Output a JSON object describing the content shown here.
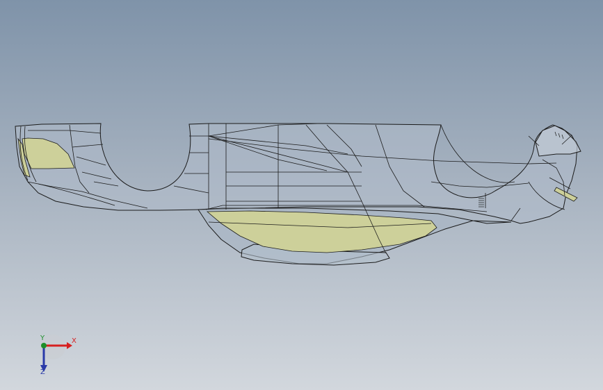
{
  "viewport": {
    "background_top": "#7f93a9",
    "background_bottom": "#d2d7dd"
  },
  "model": {
    "edge_color": "#1a1a1a",
    "body_fill": "#b0bccb",
    "face_highlight_color": "#cdd09a"
  },
  "triad": {
    "x_label": "X",
    "y_label": "Y",
    "z_label": "Z",
    "x_color": "#d62020",
    "y_color": "#1f8f2a",
    "z_color": "#2a3aa8"
  }
}
